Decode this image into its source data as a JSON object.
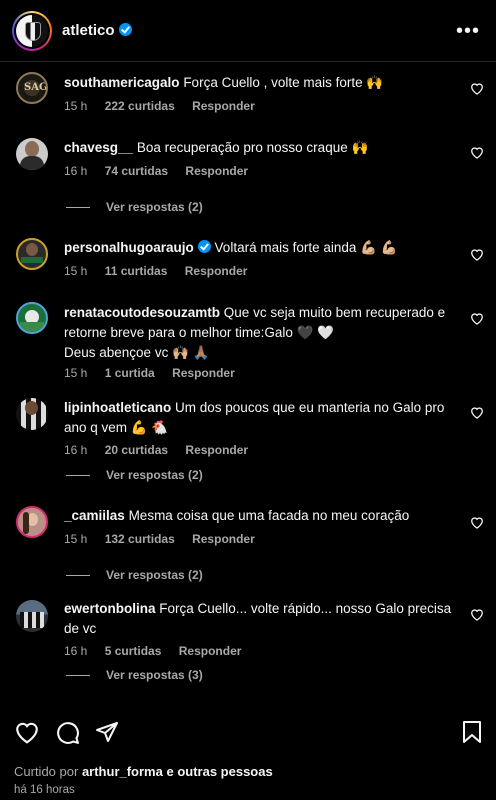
{
  "header": {
    "username": "atletico",
    "more": "•••"
  },
  "labels": {
    "reply": "Responder"
  },
  "comments": [
    {
      "user": "southamericagalo",
      "verified": false,
      "text": "Força Cuello , volte mais forte 🙌",
      "time": "15 h",
      "likes": "222 curtidas",
      "replies": ""
    },
    {
      "user": "chavesg__",
      "verified": false,
      "text": "Boa recuperação pro nosso craque 🙌",
      "time": "16 h",
      "likes": "74 curtidas",
      "replies": "Ver respostas (2)"
    },
    {
      "user": "personalhugoaraujo",
      "verified": true,
      "text": "Voltará mais forte ainda 💪🏼 💪🏼",
      "time": "15 h",
      "likes": "11 curtidas",
      "replies": ""
    },
    {
      "user": "renatacoutodesouzamtb",
      "verified": false,
      "text": "Que vc seja muito bem recuperado e retorne breve para o melhor time:Galo 🖤 🤍",
      "text2": "Deus abençoe vc 🙌🏼 🙏🏽",
      "time": "15 h",
      "likes": "1 curtida",
      "replies": ""
    },
    {
      "user": "lipinhoatleticano",
      "verified": false,
      "text": "Um dos poucos que eu manteria no Galo pro ano q vem 💪 🐔",
      "time": "16 h",
      "likes": "20 curtidas",
      "replies": "Ver respostas (2)"
    },
    {
      "user": "_camiilas",
      "verified": false,
      "text": "Mesma coisa que uma facada no meu coração",
      "time": "15 h",
      "likes": "132 curtidas",
      "replies": "Ver respostas (2)"
    },
    {
      "user": "ewertonbolina",
      "verified": false,
      "text": "Força Cuello... volte rápido... nosso Galo precisa de vc",
      "time": "16 h",
      "likes": "5 curtidas",
      "replies": "Ver respostas (3)"
    }
  ],
  "footer": {
    "liked_prefix": "Curtido por",
    "liked_user": "arthur_forma",
    "liked_suffix": "e outras pessoas",
    "posted": "há 16 horas"
  },
  "colors": {
    "background": "#000000",
    "text": "#f5f5f5",
    "muted": "#a8a8a8",
    "verified": "#0095f6"
  },
  "icons": [
    "heart-icon",
    "comment-icon",
    "share-icon",
    "bookmark-icon",
    "more-icon",
    "verified-icon"
  ]
}
